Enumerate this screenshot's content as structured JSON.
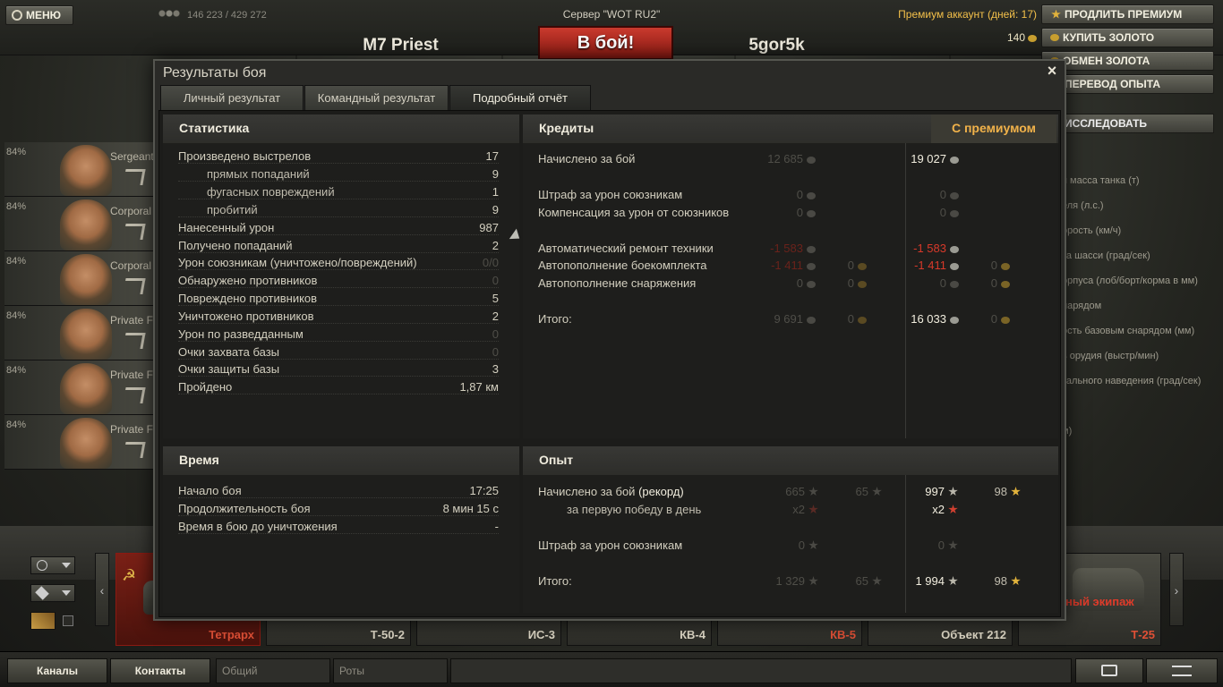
{
  "header": {
    "menu_label": "МЕНЮ",
    "players_online": "146 223 / 429 272",
    "server": "Сервер \"WOT RU2\"",
    "tank_name": "M7 Priest",
    "battle_button": "В бой!",
    "player_name": "5gor5k",
    "premium_text": "Премиум аккаунт (дней:  17)",
    "gold_amount": "140",
    "right_buttons": [
      "ПРОДЛИТЬ ПРЕМИУМ",
      "КУПИТЬ ЗОЛОТО",
      "ОБМЕН ЗОЛОТА",
      "ПЕРЕВОД ОПЫТА"
    ],
    "research_button": "ИССЛЕДОВАТЬ"
  },
  "crew": [
    {
      "percent": "84%",
      "rank": "Sergeant"
    },
    {
      "percent": "84%",
      "rank": "Corporal"
    },
    {
      "percent": "84%",
      "rank": "Corporal"
    },
    {
      "percent": "84%",
      "rank": "Private F"
    },
    {
      "percent": "84%",
      "rank": "Private F"
    },
    {
      "percent": "84%",
      "rank": "Private F"
    }
  ],
  "specs": [
    "я масса танка (т)",
    "еля (л.с.)",
    "орость (км/ч)",
    "та шасси (град/сек)",
    "орпуса (лоб/борт/корма в мм)",
    "нарядом",
    "ость базовым снарядом (мм)",
    "ь орудия (выстр/мин)",
    "тального наведения (град/сек)",
    "м)"
  ],
  "carousel": {
    "tanks": [
      "Тетрарх",
      "Т-50-2",
      "ИС-3",
      "КВ-4",
      "КВ-5",
      "Объект 212",
      "Т-25"
    ],
    "crew_label": "ный экипаж"
  },
  "bottombar": {
    "channels": "Каналы",
    "contacts": "Контакты",
    "field_general": "Общий",
    "field_companies": "Роты"
  },
  "dialog": {
    "title": "Результаты боя",
    "tabs": [
      "Личный результат",
      "Командный результат",
      "Подробный отчёт"
    ],
    "stats": {
      "title": "Статистика",
      "rows": [
        {
          "label": "Произведено выстрелов",
          "value": "17"
        },
        {
          "label": "прямых попаданий",
          "value": "9"
        },
        {
          "label": "фугасных повреждений",
          "value": "1"
        },
        {
          "label": "пробитий",
          "value": "9"
        },
        {
          "label": "Нанесенный урон",
          "value": "987"
        },
        {
          "label": "Получено попаданий",
          "value": "2"
        },
        {
          "label": "Урон союзникам (уничтожено/повреждений)",
          "value": "0/0"
        },
        {
          "label": "Обнаружено противников",
          "value": "0"
        },
        {
          "label": "Повреждено противников",
          "value": "5"
        },
        {
          "label": "Уничтожено противников",
          "value": "2"
        },
        {
          "label": "Урон по разведданным",
          "value": "0"
        },
        {
          "label": "Очки захвата базы",
          "value": "0"
        },
        {
          "label": "Очки защиты базы",
          "value": "3"
        },
        {
          "label": "Пройдено",
          "value": "1,87 км"
        }
      ]
    },
    "credits": {
      "title": "Кредиты",
      "premium_title": "С премиумом",
      "rows": [
        {
          "label": "Начислено за бой",
          "base": "12 685",
          "base_gold": "",
          "prem": "19 027",
          "prem_gold": ""
        },
        {
          "label": "Штраф за урон союзникам",
          "base": "0",
          "base_gold": "",
          "prem": "0",
          "prem_gold": ""
        },
        {
          "label": "Компенсация за урон от союзников",
          "base": "0",
          "base_gold": "",
          "prem": "0",
          "prem_gold": ""
        },
        {
          "label": "Автоматический ремонт техники",
          "base": "-1 583",
          "base_gold": "",
          "prem": "-1 583",
          "prem_gold": ""
        },
        {
          "label": "Автопополнение боекомплекта",
          "base": "-1 411",
          "base_gold": "0",
          "prem": "-1 411",
          "prem_gold": "0"
        },
        {
          "label": "Автопополнение снаряжения",
          "base": "0",
          "base_gold": "0",
          "prem": "0",
          "prem_gold": "0"
        },
        {
          "label": "Итого:",
          "base": "9 691",
          "base_gold": "0",
          "prem": "16 033",
          "prem_gold": "0"
        }
      ]
    },
    "time": {
      "title": "Время",
      "rows": [
        {
          "label": "Начало боя",
          "value": "17:25"
        },
        {
          "label": "Продолжительность боя",
          "value": "8 мин 15 с"
        },
        {
          "label": "Время в бою до уничтожения",
          "value": "-"
        }
      ]
    },
    "experience": {
      "title": "Опыт",
      "earned_label": "Начислено за бой ",
      "earned_record": "(рекорд)",
      "first_win_label": "за первую победу в день",
      "penalty_label": "Штраф за урон союзникам",
      "total_label": "Итого:",
      "earned": {
        "base": "665",
        "base_free": "65",
        "prem": "997",
        "prem_free": "98"
      },
      "first_win": {
        "base": "x2",
        "prem": "x2"
      },
      "penalty": {
        "base": "0",
        "prem": "0"
      },
      "total": {
        "base": "1 329",
        "base_free": "65",
        "prem": "1 994",
        "prem_free": "98"
      }
    }
  }
}
